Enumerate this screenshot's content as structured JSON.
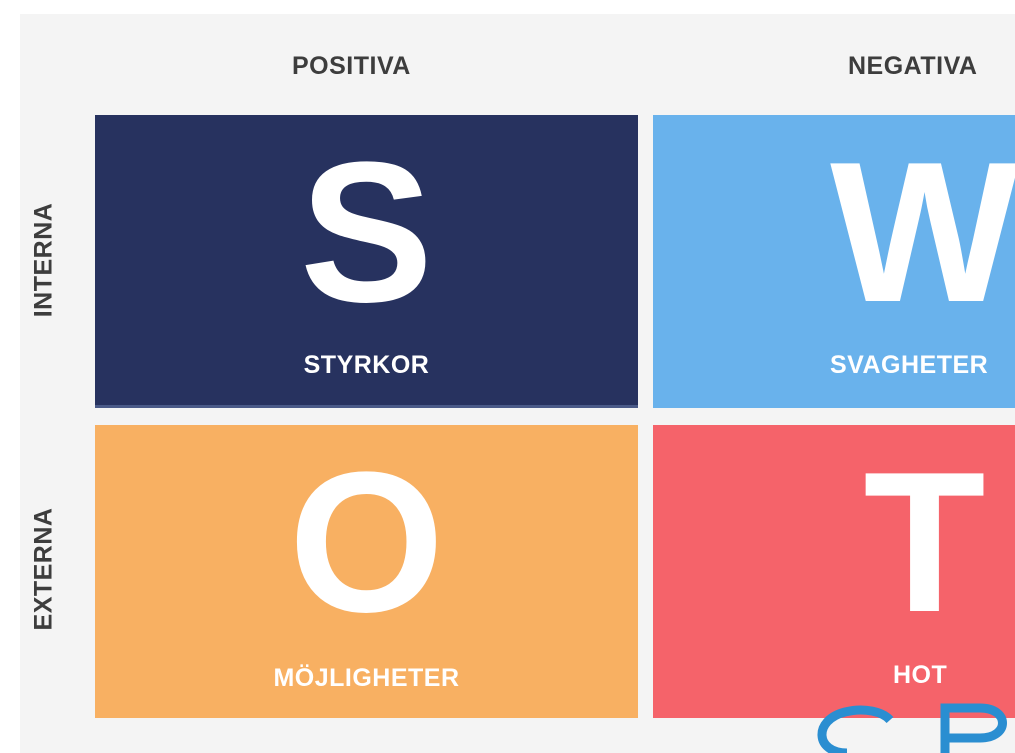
{
  "headers": {
    "positive": "POSITIVA",
    "negative": "NEGATIVA"
  },
  "rows": {
    "internal": "INTERNA",
    "external": "EXTERNA"
  },
  "quadrants": {
    "strengths": {
      "letter": "S",
      "label": "STYRKOR",
      "color": "#27325f"
    },
    "weaknesses": {
      "letter": "W",
      "label": "SVAGHETER",
      "color": "#69b2ec"
    },
    "opportunities": {
      "letter": "O",
      "label": "MÖJLIGHETER",
      "color": "#f8b062"
    },
    "threats": {
      "letter": "T",
      "label": "HOT",
      "color": "#f5636a"
    }
  },
  "colors": {
    "panel_bg": "#f4f4f4",
    "header_text": "#3d3d3d",
    "overlay_accent": "#2a8ed1"
  }
}
